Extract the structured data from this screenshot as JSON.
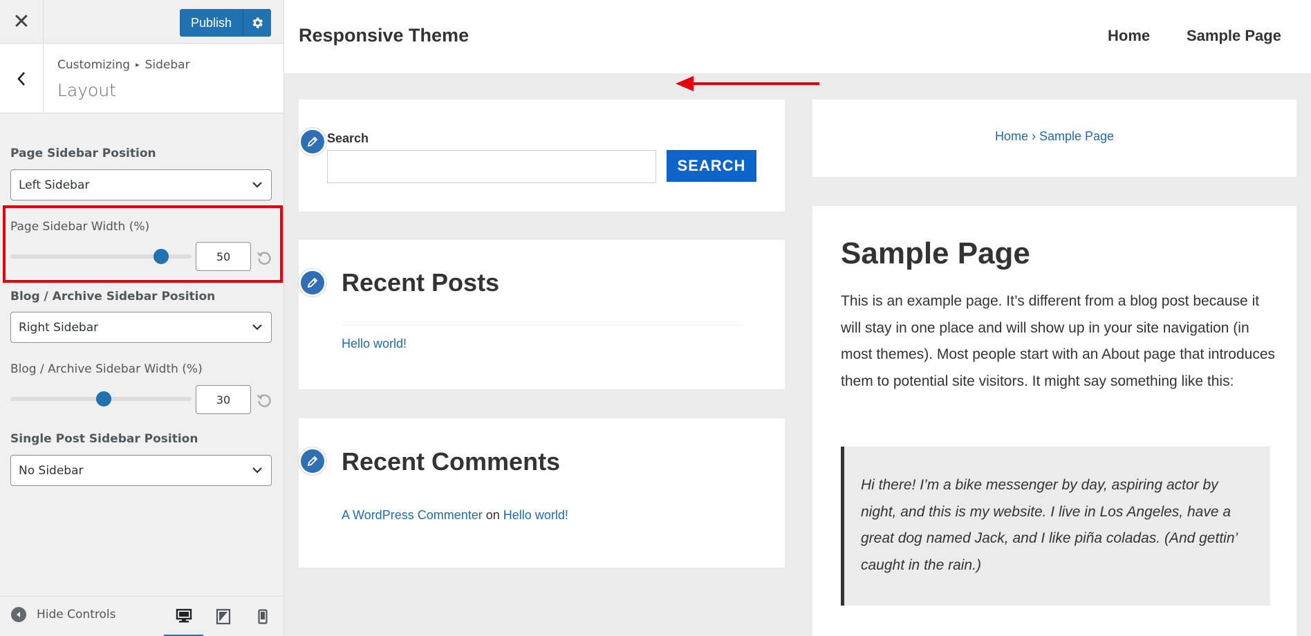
{
  "customizer": {
    "close_icon": "close-icon",
    "publish_label": "Publish",
    "settings_icon": "gear-icon",
    "breadcrumb_root": "Customizing",
    "breadcrumb_section": "Sidebar",
    "section_title": "Layout",
    "controls": {
      "page_position": {
        "label": "Page Sidebar Position",
        "value": "Left Sidebar"
      },
      "page_width": {
        "label": "Page Sidebar Width (%)",
        "value": "50",
        "percent": 50
      },
      "blog_position": {
        "label": "Blog / Archive Sidebar Position",
        "value": "Right Sidebar"
      },
      "blog_width": {
        "label": "Blog / Archive Sidebar Width (%)",
        "value": "30",
        "percent": 30
      },
      "single_position": {
        "label": "Single Post Sidebar Position",
        "value": "No Sidebar"
      }
    },
    "footer": {
      "hide_controls": "Hide Controls",
      "devices": [
        "desktop",
        "tablet",
        "mobile"
      ],
      "active_device": "desktop"
    },
    "accent_color": "#2271b1",
    "highlight_color": "#e8000f"
  },
  "site": {
    "title": "Responsive Theme",
    "nav": [
      "Home",
      "Sample Page"
    ],
    "search_widget": {
      "label": "Search",
      "button": "SEARCH"
    },
    "recent_posts": {
      "title": "Recent Posts",
      "items": [
        "Hello world!"
      ]
    },
    "recent_comments": {
      "title": "Recent Comments",
      "author": "A WordPress Commenter",
      "connector": "on",
      "post": "Hello world!"
    },
    "breadcrumb": {
      "home": "Home",
      "sep": "›",
      "current": "Sample Page"
    },
    "page": {
      "title": "Sample Page",
      "body": "This is an example page. It’s different from a blog post because it will stay in one place and will show up in your site navigation (in most themes). Most people start with an About page that introduces them to potential site visitors. It might say something like this:",
      "quote": "Hi there! I’m a bike messenger by day, aspiring actor by night, and this is my website. I live in Los Angeles, have a great dog named Jack, and I like piña coladas. (And gettin’ caught in the rain.)"
    },
    "link_color": "#1e6aad",
    "button_color": "#0e64c8"
  }
}
